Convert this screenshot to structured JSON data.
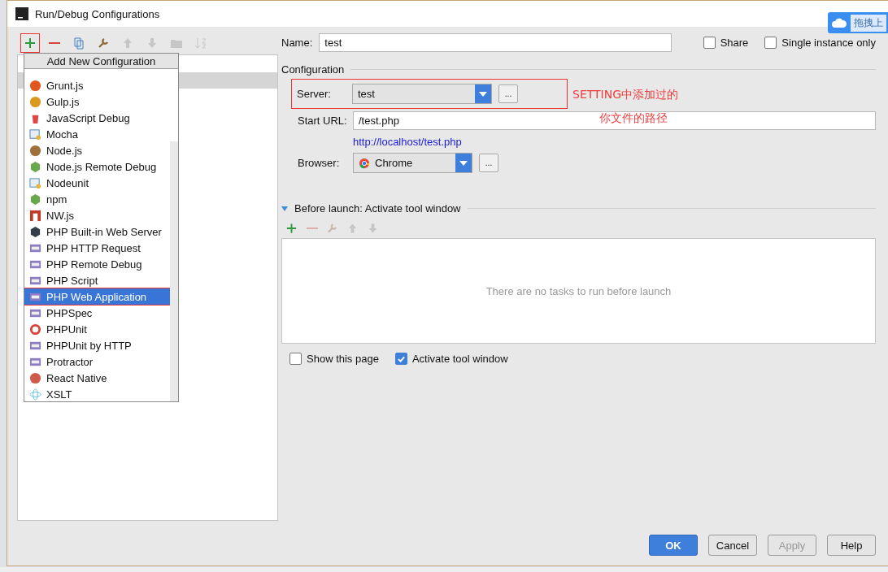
{
  "window": {
    "title": "Run/Debug Configurations"
  },
  "toolbar": [
    {
      "kind": "add",
      "disabled": false,
      "annotated": true
    },
    {
      "kind": "remove",
      "disabled": false,
      "annotated": false
    },
    {
      "kind": "copy",
      "disabled": false,
      "annotated": false
    },
    {
      "kind": "edit",
      "disabled": false,
      "annotated": false
    },
    {
      "kind": "up",
      "disabled": true,
      "annotated": false
    },
    {
      "kind": "down",
      "disabled": true,
      "annotated": false
    },
    {
      "kind": "folder",
      "disabled": true,
      "annotated": false
    },
    {
      "kind": "sort",
      "disabled": true,
      "annotated": false
    }
  ],
  "popup": {
    "title": "Add New Configuration",
    "items": [
      {
        "label": "Grunt.js",
        "selected": false,
        "annotated": false
      },
      {
        "label": "Gulp.js",
        "selected": false,
        "annotated": false
      },
      {
        "label": "JavaScript Debug",
        "selected": false,
        "annotated": false
      },
      {
        "label": "Mocha",
        "selected": false,
        "annotated": false
      },
      {
        "label": "Node.js",
        "selected": false,
        "annotated": false
      },
      {
        "label": "Node.js Remote Debug",
        "selected": false,
        "annotated": false
      },
      {
        "label": "Nodeunit",
        "selected": false,
        "annotated": false
      },
      {
        "label": "npm",
        "selected": false,
        "annotated": false
      },
      {
        "label": "NW.js",
        "selected": false,
        "annotated": false
      },
      {
        "label": "PHP Built-in Web Server",
        "selected": false,
        "annotated": false
      },
      {
        "label": "PHP HTTP Request",
        "selected": false,
        "annotated": false
      },
      {
        "label": "PHP Remote Debug",
        "selected": false,
        "annotated": false
      },
      {
        "label": "PHP Script",
        "selected": false,
        "annotated": false
      },
      {
        "label": "PHP Web Application",
        "selected": true,
        "annotated": true
      },
      {
        "label": "PHPSpec",
        "selected": false,
        "annotated": false
      },
      {
        "label": "PHPUnit",
        "selected": false,
        "annotated": false
      },
      {
        "label": "PHPUnit by HTTP",
        "selected": false,
        "annotated": false
      },
      {
        "label": "Protractor",
        "selected": false,
        "annotated": false
      },
      {
        "label": "React Native",
        "selected": false,
        "annotated": false
      },
      {
        "label": "XSLT",
        "selected": false,
        "annotated": false
      }
    ]
  },
  "name": {
    "label": "Name:",
    "value": "test"
  },
  "flags": [
    {
      "label": "Share",
      "checked": false
    },
    {
      "label": "Single instance only",
      "checked": false
    }
  ],
  "configuration": {
    "title": "Configuration",
    "server": {
      "label": "Server:",
      "value": "test",
      "annotated": true,
      "more": "..."
    },
    "start_url": {
      "label": "Start URL:",
      "value": "/test.php"
    },
    "url_preview": "http://localhost/test.php",
    "browser": {
      "label": "Browser:",
      "value": "Chrome",
      "more": "..."
    }
  },
  "notes": [
    "SETTING中添加过的",
    "你文件的路径"
  ],
  "before_launch": {
    "title": "Before launch: Activate tool window",
    "expanded": true,
    "empty_text": "There are no tasks to run before launch",
    "tools": [
      {
        "kind": "add",
        "disabled": false
      },
      {
        "kind": "remove",
        "disabled": true
      },
      {
        "kind": "edit",
        "disabled": true
      },
      {
        "kind": "up",
        "disabled": true
      },
      {
        "kind": "down",
        "disabled": true
      }
    ]
  },
  "options": [
    {
      "label": "Show this page",
      "checked": false
    },
    {
      "label": "Activate tool window",
      "checked": true
    }
  ],
  "buttons": [
    {
      "label": "OK",
      "kind": "primary"
    },
    {
      "label": "Cancel",
      "kind": "normal"
    },
    {
      "label": "Apply",
      "kind": "disabled"
    },
    {
      "label": "Help",
      "kind": "normal"
    }
  ],
  "upload_widget": {
    "label": "拖拽上"
  }
}
